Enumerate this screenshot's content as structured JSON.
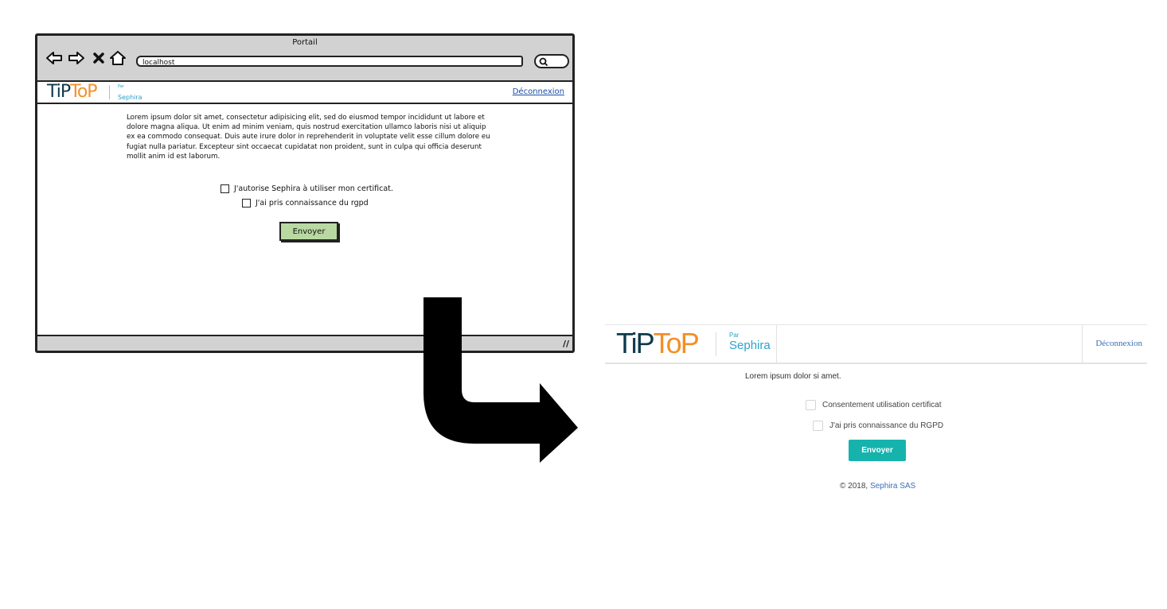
{
  "wireframe": {
    "window_title": "Portail",
    "url": "localhost",
    "logo": {
      "ti": "TiP",
      "top": "ToP"
    },
    "par_small": "Par",
    "par_name": "Sephira",
    "logout": "Déconnexion",
    "paragraph": "Lorem ipsum dolor sit amet, consectetur adipisicing elit, sed do eiusmod tempor incididunt ut labore et dolore magna aliqua. Ut enim ad minim veniam, quis nostrud exercitation ullamco laboris nisi ut aliquip ex ea commodo consequat. Duis aute irure dolor in reprehenderit in voluptate velit esse cillum dolore eu fugiat nulla pariatur. Excepteur sint occaecat cupidatat non proident, sunt in culpa qui officia deserunt mollit anim id est laborum.",
    "checkbox_1": "J'autorise Sephira à utiliser mon certificat.",
    "checkbox_2": "J'ai pris connaissance du rgpd",
    "send_button": "Envoyer",
    "icons": [
      "back-arrow-icon",
      "forward-arrow-icon",
      "close-icon",
      "home-icon",
      "search-icon",
      "resize-grip-icon"
    ]
  },
  "rendered": {
    "logo": {
      "ti": "TiP",
      "top": "ToP"
    },
    "par_small": "Par",
    "par_name": "Sephira",
    "logout": "Déconnexion",
    "text": "Lorem ipsum dolor si amet.",
    "checkbox_1": "Consentement utilisation certificat",
    "checkbox_2": "J'ai pris connaissance du RGPD",
    "send_button": "Envoyer",
    "footer_prefix": "© 2018,",
    "footer_link": "Sephira SAS"
  },
  "colors": {
    "logo_dark": "#0d3a4c",
    "logo_orange": "#f58e25",
    "sephira_blue": "#2aa3cc",
    "button_teal": "#16b3ad",
    "wireframe_button_green": "#b9d9a2",
    "link_blue": "#3a6fb5"
  }
}
